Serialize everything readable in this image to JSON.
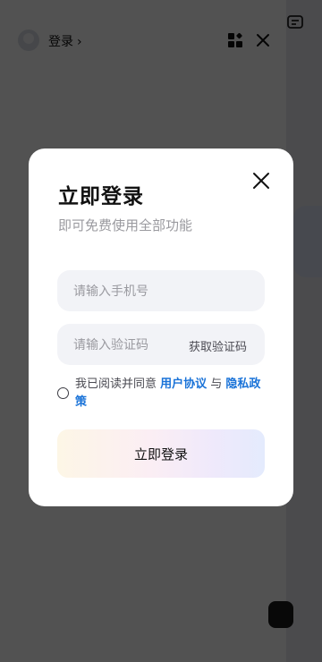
{
  "header": {
    "login_label": "登录",
    "chevron": "›",
    "icons": [
      "avatar",
      "grid-icon",
      "close-icon"
    ]
  },
  "modal": {
    "title": "立即登录",
    "subtitle": "即可免费使用全部功能",
    "close_icon": "close-icon",
    "phone_placeholder": "请输入手机号",
    "code_placeholder": "请输入验证码",
    "get_code_label": "获取验证码",
    "agreement": {
      "prefix": "我已阅读并同意 ",
      "user_agreement": "用户协议",
      "connector": " 与 ",
      "privacy_policy": "隐私政策"
    },
    "submit_label": "立即登录"
  },
  "colors": {
    "link": "#1a73d8",
    "overlay": "rgba(0,0,0,0.68)",
    "field_bg": "#f2f3f7"
  }
}
